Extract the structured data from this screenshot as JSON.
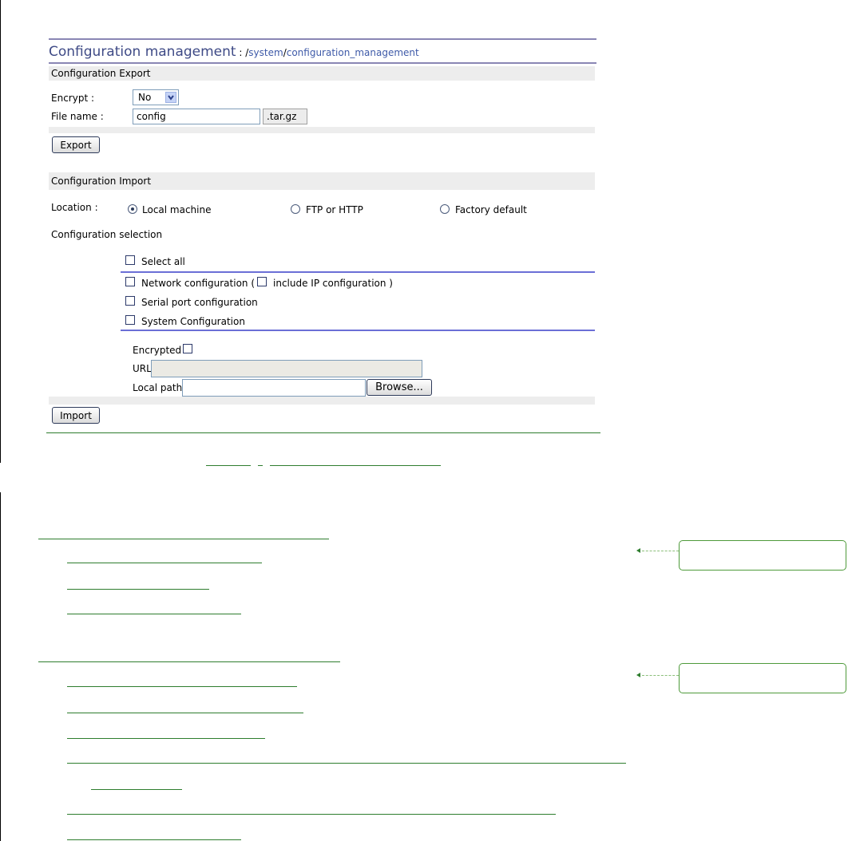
{
  "page": {
    "title": "Configuration management",
    "path_separator_prefix": " : /",
    "path_part1": "system",
    "path_slash": "/",
    "path_part2": "configuration_management"
  },
  "export": {
    "section_title": "Configuration Export",
    "encrypt_label": "Encrypt :",
    "encrypt_value": "No",
    "filename_label": "File name :",
    "filename_value": "config",
    "filename_suffix": ".tar.gz",
    "export_button": "Export"
  },
  "import": {
    "section_title": "Configuration Import",
    "location_label": "Location :",
    "locations": [
      "Local machine",
      "FTP or HTTP",
      "Factory default"
    ],
    "selected_location": "Local machine",
    "selection_label": "Configuration selection",
    "select_all": "Select all",
    "network_prefix": "Network configuration (",
    "include_ip": "include IP configuration )",
    "serial": "Serial port configuration",
    "system": "System Configuration",
    "encrypted_label": "Encrypted :",
    "url_label": "URL :",
    "url_value": "",
    "local_path_label": "Local path :",
    "local_path_value": "",
    "browse_button": "Browse...",
    "import_button": "Import"
  },
  "colors": {
    "title": "#3e4a86",
    "link_green": "#2e7d2e",
    "section_bg": "#ededed",
    "divider_blue": "#6b6fd6"
  }
}
